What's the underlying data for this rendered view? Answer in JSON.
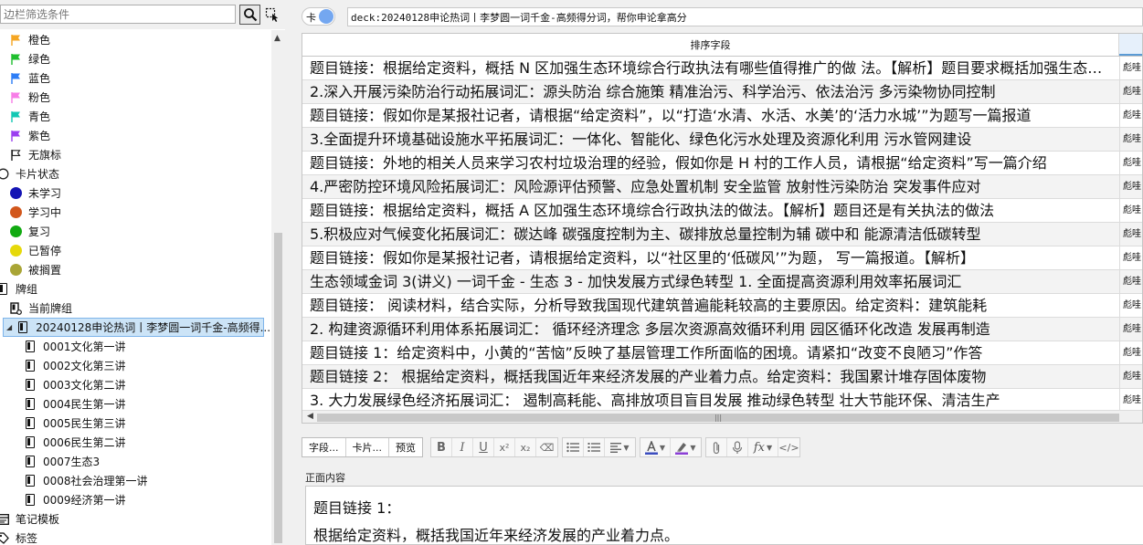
{
  "sidebar": {
    "filter_placeholder": "边栏筛选条件",
    "filter_value": "边栏筛选条件",
    "items": [
      {
        "label": "橙色",
        "icon": "orange-flag-icon",
        "kind": "flag",
        "color": "#f5a623"
      },
      {
        "label": "绿色",
        "icon": "green-flag-icon",
        "kind": "flag",
        "color": "#1fbf2e"
      },
      {
        "label": "蓝色",
        "icon": "blue-flag-icon",
        "kind": "flag",
        "color": "#2d7df6"
      },
      {
        "label": "粉色",
        "icon": "pink-flag-icon",
        "kind": "flag",
        "color": "#f77de7"
      },
      {
        "label": "青色",
        "icon": "teal-flag-icon",
        "kind": "flag",
        "color": "#12c8b4"
      },
      {
        "label": "紫色",
        "icon": "purple-flag-icon",
        "kind": "flag",
        "color": "#9b3ff0"
      },
      {
        "label": "无旗标",
        "icon": "no-flag-icon",
        "kind": "flag-outline",
        "color": "#222222"
      },
      {
        "label": "卡片状态",
        "icon": "card-state-icon",
        "kind": "circle-outline",
        "color": "#222222"
      },
      {
        "label": "未学习",
        "icon": "new-state-icon",
        "kind": "dot",
        "color": "#1414b4"
      },
      {
        "label": "学习中",
        "icon": "learning-state-icon",
        "kind": "dot",
        "color": "#d2571c"
      },
      {
        "label": "复习",
        "icon": "review-state-icon",
        "kind": "dot",
        "color": "#11aa11"
      },
      {
        "label": "已暂停",
        "icon": "suspended-state-icon",
        "kind": "dot",
        "color": "#e6d90a"
      },
      {
        "label": "被搁置",
        "icon": "buried-state-icon",
        "kind": "dot",
        "color": "#a9a536"
      },
      {
        "label": "牌组",
        "icon": "decks-icon",
        "kind": "card",
        "color": "#111111"
      },
      {
        "label": "当前牌组",
        "icon": "current-deck-icon",
        "kind": "current",
        "color": "#111111"
      },
      {
        "label": "20240128申论热词丨李梦圆一词千金-高频得...",
        "icon": "deck-icon",
        "kind": "card",
        "color": "#111111"
      },
      {
        "label": "0001文化第一讲",
        "icon": "deck-icon",
        "kind": "card",
        "color": "#111111"
      },
      {
        "label": "0002文化第三讲",
        "icon": "deck-icon",
        "kind": "card",
        "color": "#111111"
      },
      {
        "label": "0003文化第二讲",
        "icon": "deck-icon",
        "kind": "card",
        "color": "#111111"
      },
      {
        "label": "0004民生第一讲",
        "icon": "deck-icon",
        "kind": "card",
        "color": "#111111"
      },
      {
        "label": "0005民生第三讲",
        "icon": "deck-icon",
        "kind": "card",
        "color": "#111111"
      },
      {
        "label": "0006民生第二讲",
        "icon": "deck-icon",
        "kind": "card",
        "color": "#111111"
      },
      {
        "label": "0007生态3",
        "icon": "deck-icon",
        "kind": "card",
        "color": "#111111"
      },
      {
        "label": "0008社会治理第一讲",
        "icon": "deck-icon",
        "kind": "card",
        "color": "#111111"
      },
      {
        "label": "0009经济第一讲",
        "icon": "deck-icon",
        "kind": "card",
        "color": "#111111"
      },
      {
        "label": "笔记模板",
        "icon": "note-types-icon",
        "kind": "notetype",
        "color": "#111111"
      },
      {
        "label": "标签",
        "icon": "tags-icon",
        "kind": "tag",
        "color": "#111111"
      }
    ]
  },
  "toggle": {
    "label": "卡"
  },
  "search": {
    "value": "deck:20240128申论热词丨李梦圆一词千金-高频得分词，帮你申论拿高分"
  },
  "grid": {
    "columns": [
      "排序字段",
      ""
    ],
    "rows": [
      {
        "sort": "题目链接：根据给定资料，概括 N 区加强生态环境综合行政执法有哪些值得推广的做 法。【解析】题目要求概括加强生态环境综合行政执法的做法",
        "deck": "彪哇"
      },
      {
        "sort": "2.深入开展污染防治行动拓展词汇：源头防治 综合施策 精准治污、科学治污、依法治污 多污染物协同控制",
        "deck": "彪哇"
      },
      {
        "sort": "题目链接：假如你是某报社记者，请根据“给定资料”，以“打造‘水清、水活、水美’的‘活力水城’”为题写一篇报道",
        "deck": "彪哇"
      },
      {
        "sort": "3.全面提升环境基础设施水平拓展词汇：一体化、智能化、绿色化污水处理及资源化利用 污水管网建设",
        "deck": "彪哇"
      },
      {
        "sort": "题目链接：外地的相关人员来学习农村垃圾治理的经验，假如你是 H 村的工作人员，请根据“给定资料”写一篇介绍",
        "deck": "彪哇"
      },
      {
        "sort": "4.严密防控环境风险拓展词汇：风险源评估预警、应急处置机制 安全监管 放射性污染防治 突发事件应对",
        "deck": "彪哇"
      },
      {
        "sort": "题目链接：根据给定资料，概括 A 区加强生态环境综合行政执法的做法。【解析】题目还是有关执法的做法",
        "deck": "彪哇"
      },
      {
        "sort": "5.积极应对气候变化拓展词汇：碳达峰 碳强度控制为主、碳排放总量控制为辅 碳中和 能源清洁低碳转型",
        "deck": "彪哇"
      },
      {
        "sort": "题目链接：假如你是某报社记者，请根据给定资料，以“社区里的‘低碳风’”为题， 写一篇报道。【解析】",
        "deck": "彪哇"
      },
      {
        "sort": "生态领域金词 3(讲义) 一词千金 - 生态 3 - 加快发展方式绿色转型 1. 全面提高资源利用效率拓展词汇",
        "deck": "彪哇"
      },
      {
        "sort": "题目链接： 阅读材料，结合实际，分析导致我国现代建筑普遍能耗较高的主要原因。给定资料：建筑能耗",
        "deck": "彪哇"
      },
      {
        "sort": "2. 构建资源循环利用体系拓展词汇： 循环经济理念 多层次资源高效循环利用 园区循环化改造 发展再制造",
        "deck": "彪哇"
      },
      {
        "sort": "题目链接 1：给定资料中，小黄的“苦恼”反映了基层管理工作所面临的困境。请紧扣“改变不良陋习”作答",
        "deck": "彪哇"
      },
      {
        "sort": "题目链接 2： 根据给定资料，概括我国近年来经济发展的产业着力点。给定资料：我国累计堆存固体废物",
        "deck": "彪哇"
      },
      {
        "sort": "3. 大力发展绿色经济拓展词汇： 遏制高耗能、高排放项目盲目发展 推动绿色转型 壮大节能环保、清洁生产",
        "deck": "彪哇"
      }
    ]
  },
  "toolbar": {
    "fields_label": "字段...",
    "cards_label": "卡片...",
    "preview_label": "预览",
    "format_buttons": [
      {
        "name": "bold-button",
        "glyph": "B",
        "icon": "bold-icon"
      },
      {
        "name": "italic-button",
        "glyph": "I",
        "icon": "italic-icon"
      },
      {
        "name": "underline-button",
        "glyph": "U",
        "icon": "underline-icon"
      },
      {
        "name": "superscript-button",
        "glyph": "x²",
        "icon": "superscript-icon"
      },
      {
        "name": "subscript-button",
        "glyph": "x₂",
        "icon": "subscript-icon"
      },
      {
        "name": "eraser-button",
        "glyph": "⌫",
        "icon": "eraser-icon"
      }
    ]
  },
  "editor": {
    "field_label": "正面内容",
    "lines": [
      "题目链接 1：",
      "根据给定资料，概括我国近年来经济发展的产业着力点。"
    ]
  },
  "colors": {
    "toggle_knob": "#74a7f0",
    "selection": "#cce4f7",
    "text_color_bar": "#3b4dbf",
    "highlight_bar": "#8b3fd6"
  }
}
